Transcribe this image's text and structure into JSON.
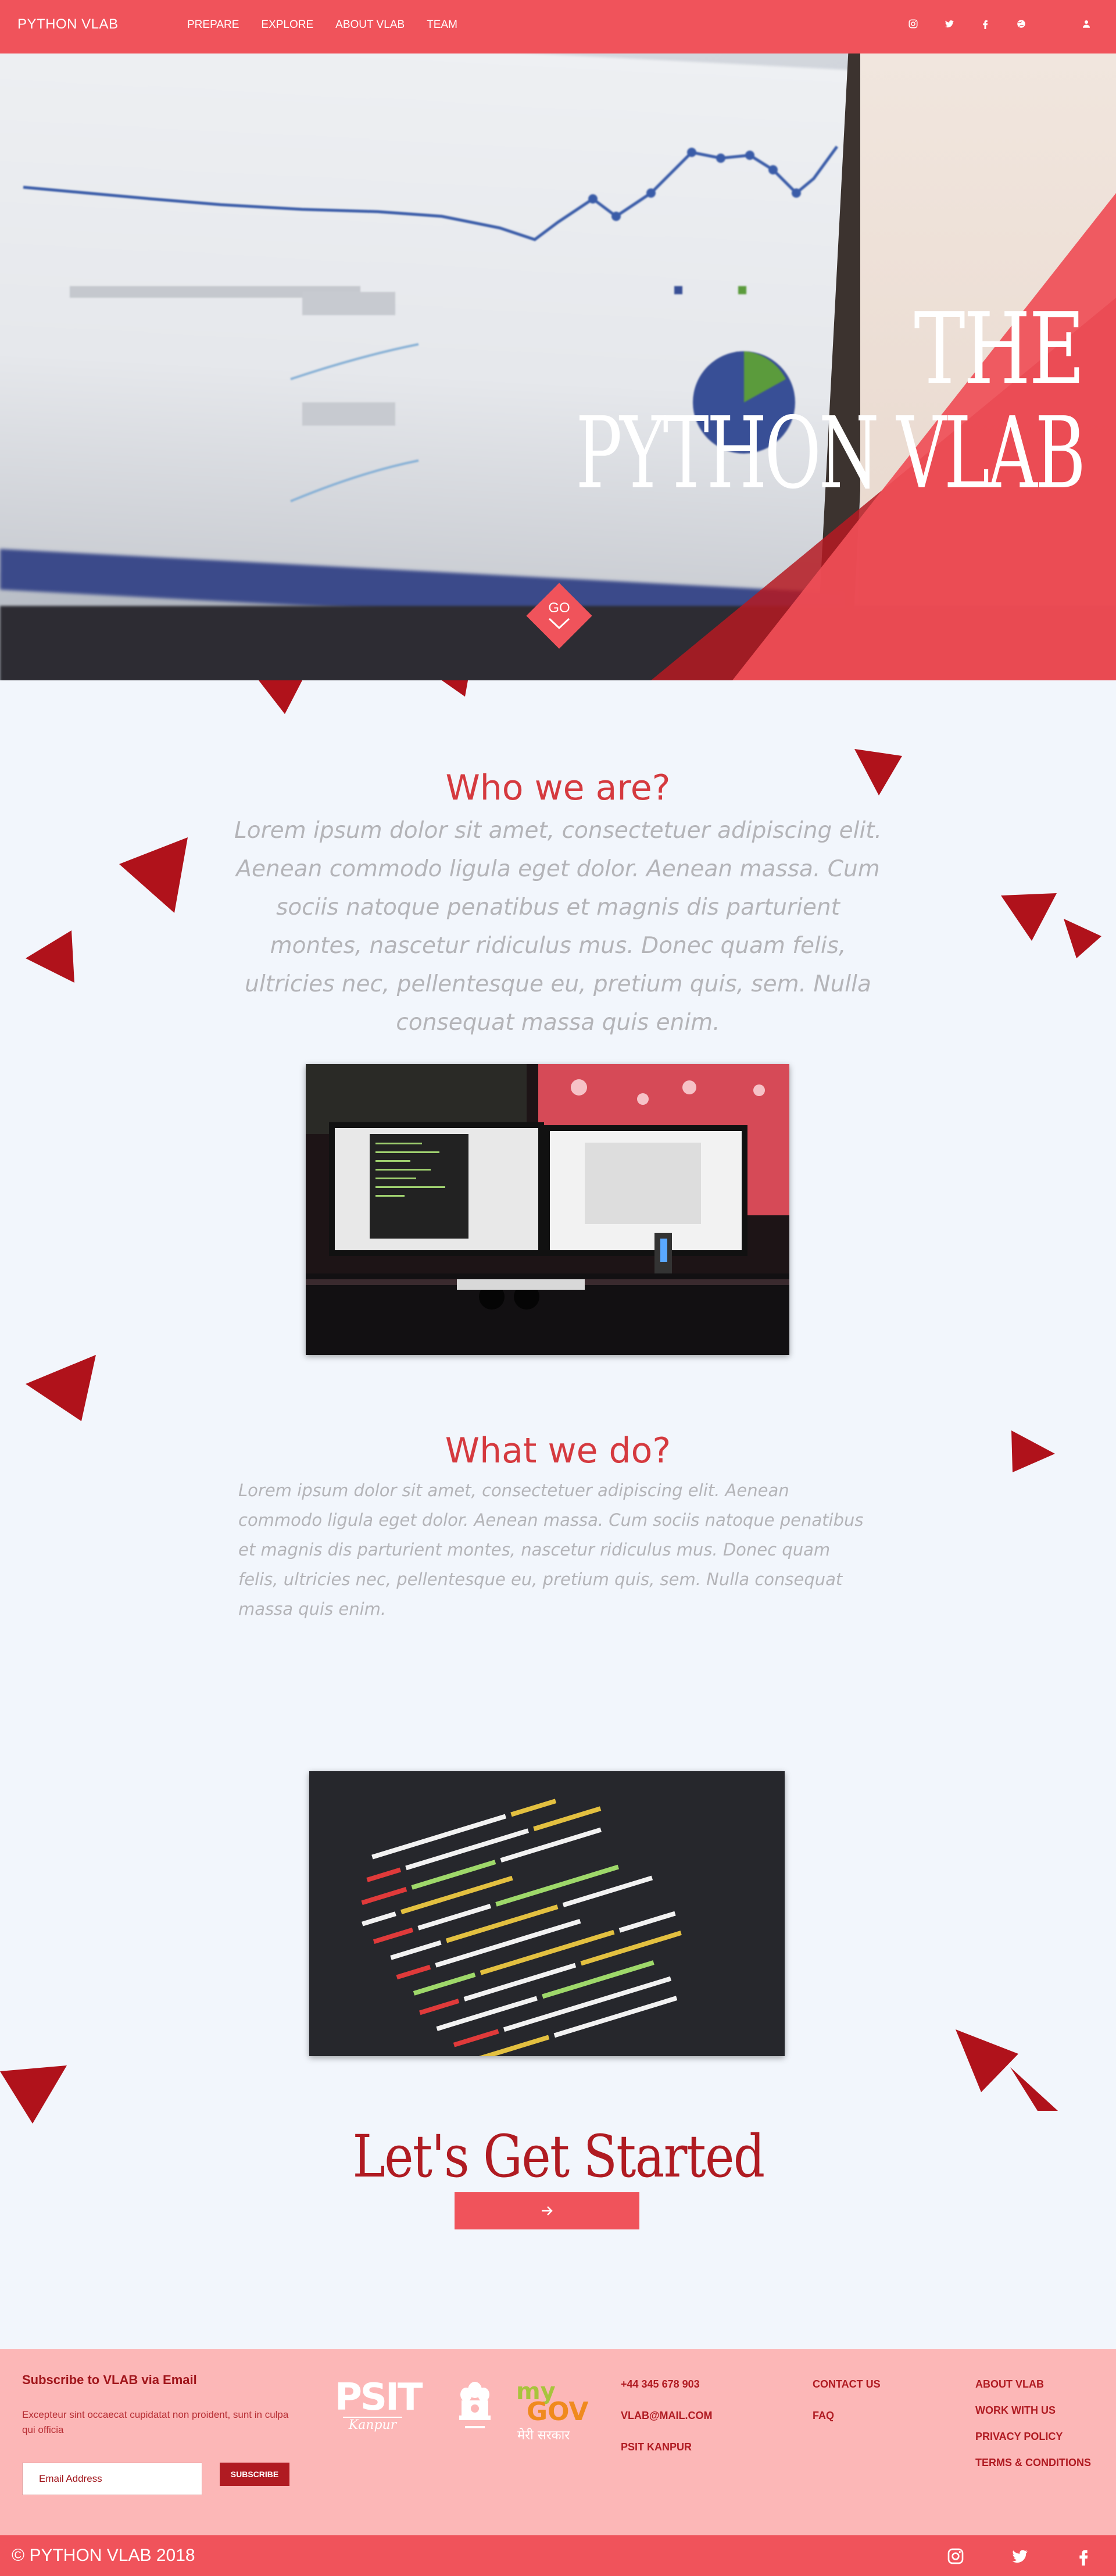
{
  "brand": "PYTHON VLAB",
  "nav": {
    "links": [
      "PREPARE",
      "EXPLORE",
      "ABOUT VLAB",
      "TEAM"
    ]
  },
  "social_icons": [
    "instagram-icon",
    "twitter-icon",
    "facebook-icon",
    "globe-icon",
    "user-icon"
  ],
  "hero": {
    "title_line1": "THE",
    "title_line2": "PYTHON VLAB",
    "go_label": "GO"
  },
  "who": {
    "title": "Who we are?",
    "text": "Lorem ipsum dolor sit amet, consectetuer adipiscing elit. Aenean commodo ligula eget dolor. Aenean massa. Cum sociis natoque penatibus et magnis dis parturient montes, nascetur ridiculus mus. Donec quam felis, ultricies nec, pellentesque eu, pretium quis, sem. Nulla consequat massa quis enim."
  },
  "what": {
    "title": "What we do?",
    "text": "Lorem ipsum dolor sit amet, consectetuer adipiscing elit. Aenean commodo ligula eget dolor. Aenean massa. Cum sociis natoque penatibus et magnis dis parturient montes, nascetur ridiculus mus. Donec quam felis, ultricies nec, pellentesque eu, pretium quis, sem. Nulla consequat massa quis enim."
  },
  "cta": {
    "title": "Let's Get Started",
    "button_icon": "arrow-right-icon"
  },
  "footer": {
    "subscribe_title": "Subscribe to VLAB via Email",
    "subscribe_text": "Excepteur sint occaecat cupidatat non proident, sunt in culpa qui officia",
    "email_placeholder": "Email Address",
    "subscribe_button": "SUBSCRIBE",
    "psit_logo": "PSIT",
    "psit_sub": "Kanpur",
    "mygov_my": "my",
    "mygov_gov": "GOV",
    "mygov_hindi": "मेरी सरकार",
    "contact": [
      "+44 345 678 903",
      "VLAB@MAIL.COM",
      "PSIT KANPUR"
    ],
    "links_col1": [
      "CONTACT US",
      "FAQ"
    ],
    "links_col2": [
      "ABOUT VLAB",
      "WORK WITH US",
      "PRIVACY POLICY",
      "TERMS & CONDITIONS"
    ]
  },
  "bottom": {
    "copyright": "© PYTHON VLAB 2018",
    "social_icons": [
      "instagram-icon",
      "twitter-icon",
      "facebook-icon"
    ]
  },
  "colors": {
    "primary": "#f0535b",
    "dark_red": "#b01b22",
    "triangle": "#b0121b",
    "background": "#f2f6fc",
    "footer": "#fcb7b7"
  }
}
